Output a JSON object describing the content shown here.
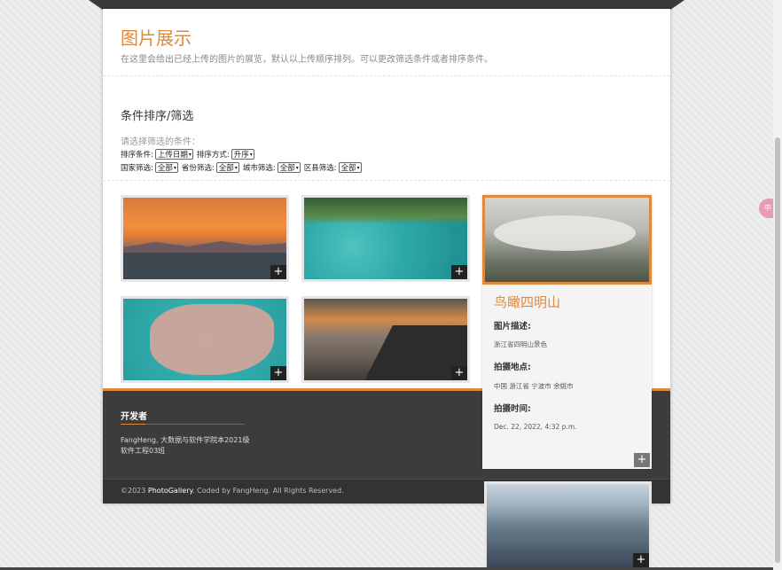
{
  "header": {
    "title": "图片展示",
    "subtitle": "在这里会给出已经上传的图片的展览，默认以上传顺序排列。可以更改筛选条件或者排序条件。"
  },
  "filter": {
    "title": "条件排序/筛选",
    "hint": "请选择筛选的条件：",
    "sort_field_label": "排序条件:",
    "sort_field_value": "上传日期",
    "sort_order_label": "排序方式:",
    "sort_order_value": "升序",
    "country_label": "国家筛选:",
    "country_value": "全部",
    "province_label": "省份筛选:",
    "province_value": "全部",
    "city_label": "城市筛选:",
    "city_value": "全部",
    "district_label": "区县筛选:",
    "district_value": "全部",
    "caret": "▾"
  },
  "gallery": {
    "plus": "+"
  },
  "detail": {
    "title": "鸟瞰四明山",
    "desc_label": "图片描述:",
    "desc_value": "浙江省四明山景色",
    "location_label": "拍摄地点:",
    "location_value": "中国 浙江省 宁波市 余姚市",
    "time_label": "拍摄时间:",
    "time_value": "Dec. 22, 2022, 4:32 p.m."
  },
  "footer": {
    "heading": "开发者",
    "text_line1": "FangHeng, 大数据与软件学院本2021级",
    "text_line2": "软件工程03班",
    "copyright_prefix": "©2023 ",
    "copyright_brand": "PhotoGallery",
    "copyright_suffix": ". Coded by FangHeng. All Rights Reserved."
  },
  "side_badge": "中",
  "colors": {
    "accent": "#e0893a",
    "footer_bg": "#3c3c3c"
  }
}
